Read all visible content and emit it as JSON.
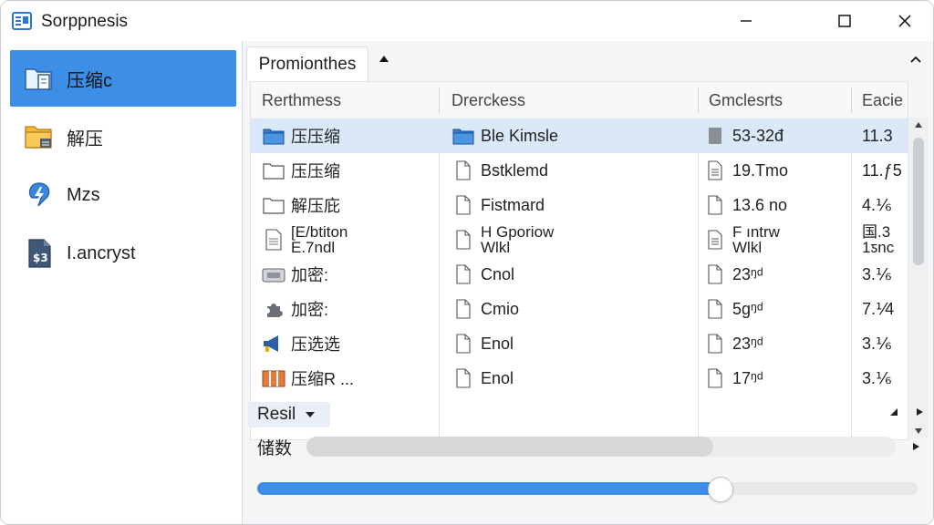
{
  "window": {
    "title": "Sorppnesis",
    "accent": "#3d8ee6"
  },
  "sidebar": {
    "items": [
      {
        "label": "压缩c",
        "icon": "folder-document-icon",
        "active": true
      },
      {
        "label": "解压",
        "icon": "folder-extract-icon",
        "active": false
      },
      {
        "label": "Mzs",
        "icon": "lightning-icon",
        "active": false
      },
      {
        "label": "I.ancryst",
        "icon": "script-file-icon",
        "active": false
      }
    ]
  },
  "tab": {
    "label": "Promionthes"
  },
  "table": {
    "columns": [
      "Rerthmess",
      "Drerckess",
      "Gmclesrts",
      "Eacie"
    ],
    "rows": [
      {
        "name": "压压缩",
        "name_icon": "folder-blue-icon",
        "type": "Ble Kimsle",
        "type_icon": "folder-blue-icon",
        "size": "53-32đ",
        "size_icon": "file-gray-icon",
        "extra": "11.3",
        "selected": true
      },
      {
        "name": "压压缩",
        "name_icon": "folder-outline-icon",
        "type": "Bstklemd",
        "type_icon": "file-icon",
        "size": "19.Tmo",
        "size_icon": "file-lines-icon",
        "extra": "11.ƒ5",
        "selected": false
      },
      {
        "name": "解压庇",
        "name_icon": "folder-outline-icon",
        "type": "Fistmard",
        "type_icon": "file-icon",
        "size": "13.6 no",
        "size_icon": "file-icon",
        "extra": "4.⅙",
        "selected": false
      },
      {
        "name": "[E/btiton",
        "name2": "E.7ndl",
        "name_icon": "document-icon",
        "type": "H Gporiow",
        "type2": "Wlkl",
        "type_icon": "file-icon",
        "size": "F ıntrw",
        "size2": "Wlkl",
        "size_icon": "file-lines-icon",
        "extra": "国.3",
        "extra2": "1ƽnc",
        "selected": false
      },
      {
        "name": "加密:",
        "name_icon": "archive-icon",
        "type": "Cnol",
        "type_icon": "file-icon",
        "size": "23ᵑᵈ",
        "size_icon": "file-icon",
        "extra": "3.⅙",
        "selected": false
      },
      {
        "name": "加密:",
        "name_icon": "puzzle-icon",
        "type": "Cmio",
        "type_icon": "file-icon",
        "size": "5gᵑᵈ",
        "size_icon": "file-icon",
        "extra": "7.⅟4",
        "selected": false
      },
      {
        "name": "压选选",
        "name_icon": "megaphone-icon",
        "type": "Enol",
        "type_icon": "file-icon",
        "size": "23ᵑᵈ",
        "size_icon": "file-icon",
        "extra": "3.⅙",
        "selected": false
      },
      {
        "name": "压缩R ...",
        "name_icon": "package-icon",
        "type": "Enol",
        "type_icon": "file-icon",
        "size": "17ᵑᵈ",
        "size_icon": "file-icon",
        "extra": "3.⅙",
        "selected": false
      }
    ]
  },
  "footer": {
    "select_value": "Resil",
    "label": "储数",
    "hbar_fraction": 0.69,
    "slider_fraction": 0.7
  }
}
